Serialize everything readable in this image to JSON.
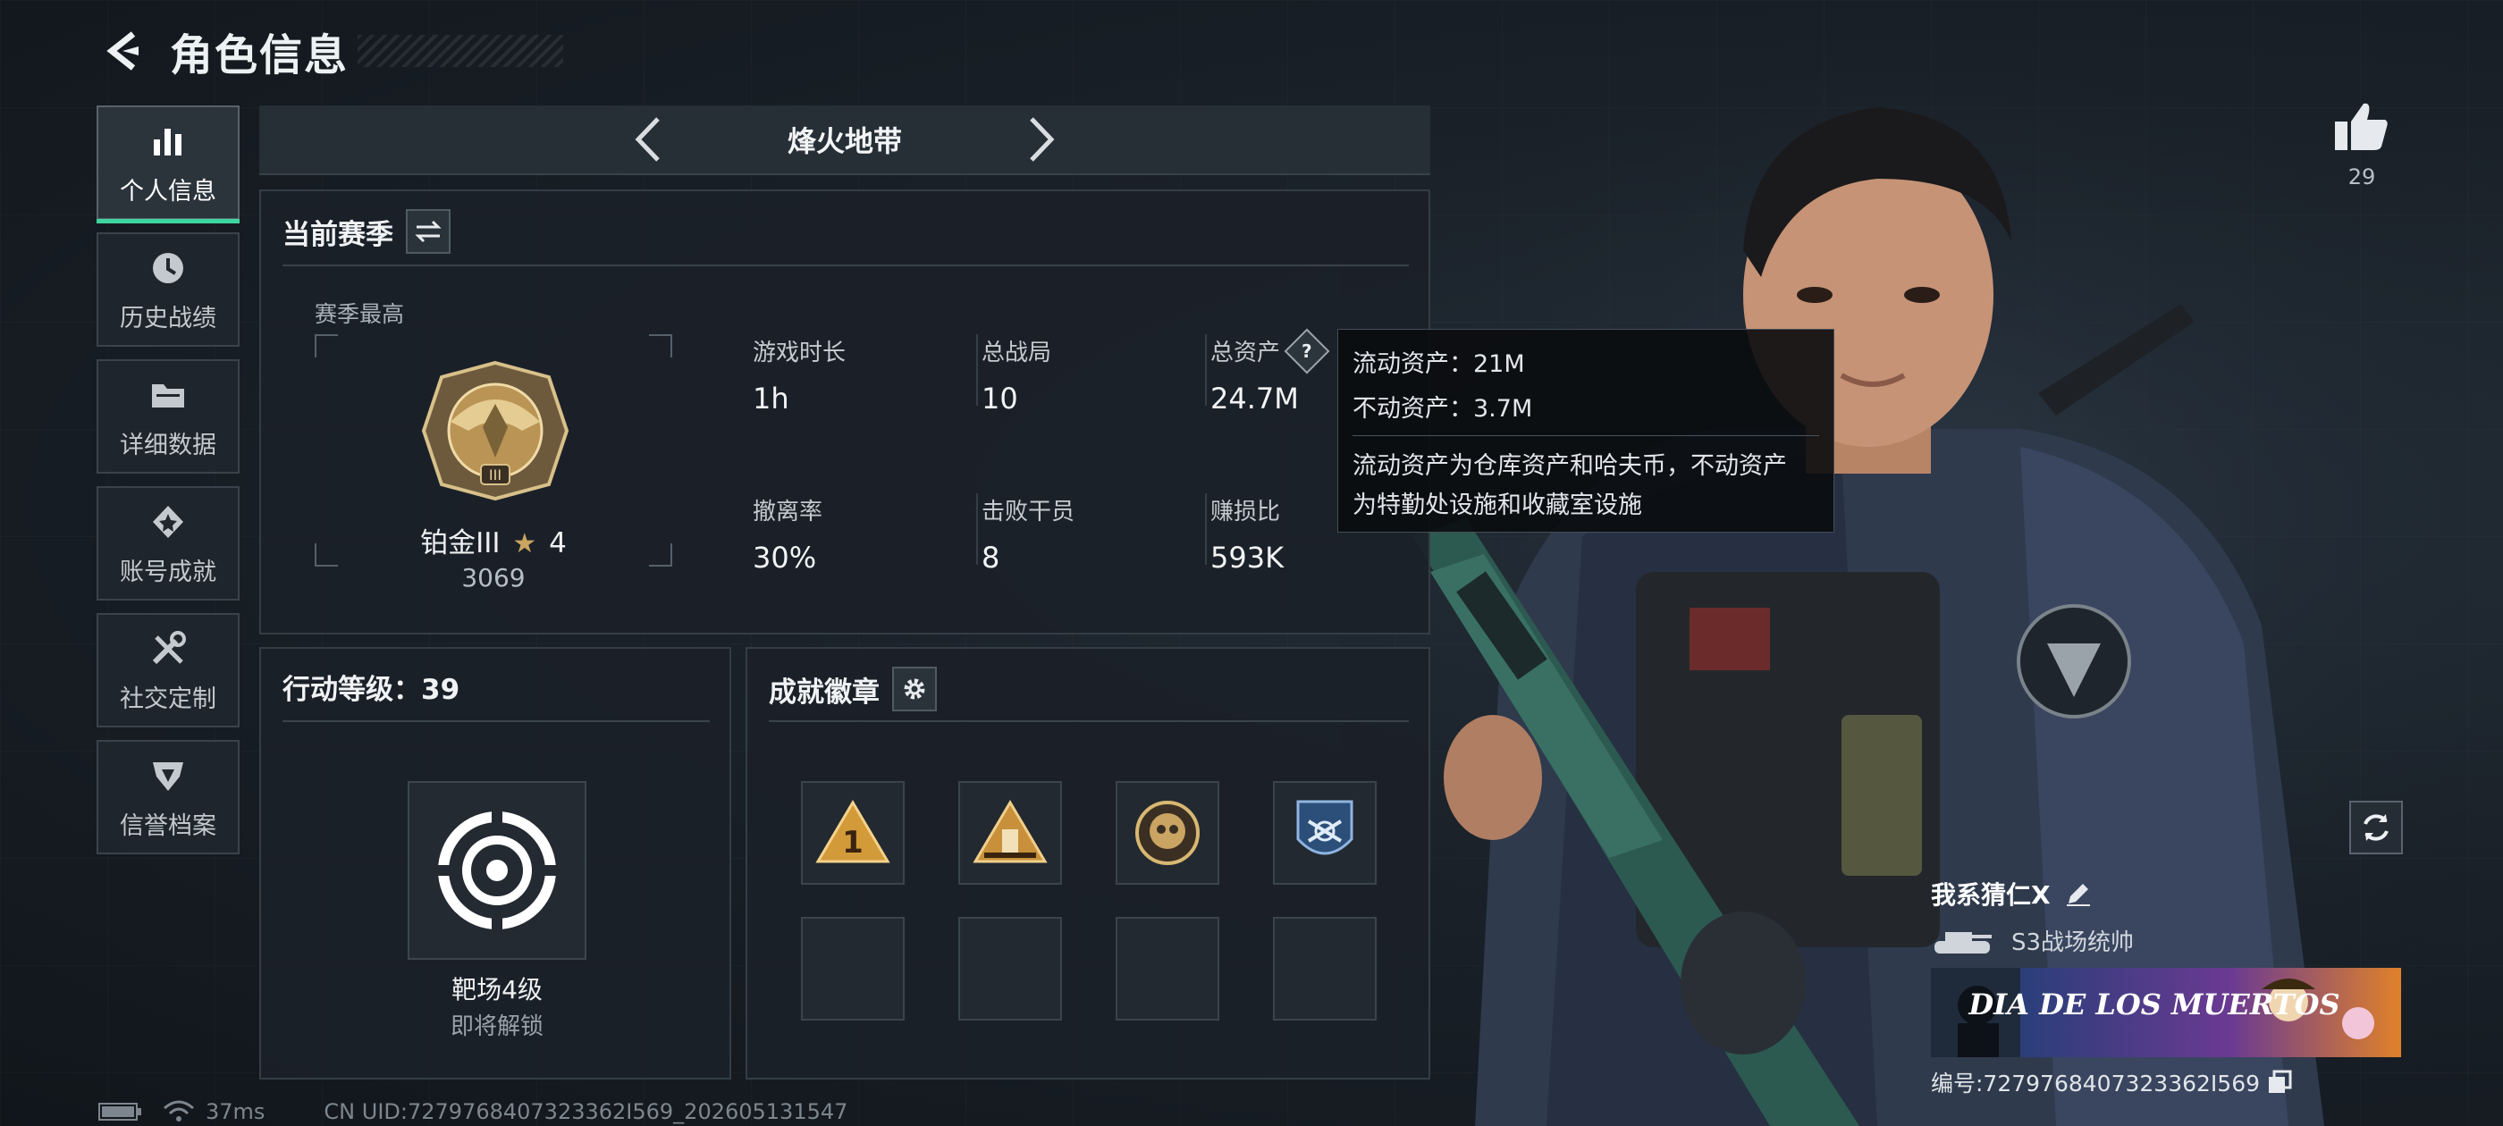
{
  "header": {
    "title": "角色信息"
  },
  "sidebar": {
    "items": [
      {
        "label": "个人信息",
        "icon": "bar-chart-icon",
        "active": true
      },
      {
        "label": "历史战绩",
        "icon": "clock-icon",
        "active": false
      },
      {
        "label": "详细数据",
        "icon": "folder-icon",
        "active": false
      },
      {
        "label": "账号成就",
        "icon": "achievement-icon",
        "active": false
      },
      {
        "label": "社交定制",
        "icon": "tools-icon",
        "active": false
      },
      {
        "label": "信誉档案",
        "icon": "shield-icon",
        "active": false
      }
    ]
  },
  "mode": {
    "title": "烽火地带"
  },
  "season": {
    "title": "当前赛季",
    "best_label": "赛季最高",
    "rank_name": "铂金III",
    "rank_stars": "4",
    "rank_score": "3069",
    "stats": [
      {
        "label": "游戏时长",
        "value": "1h"
      },
      {
        "label": "总战局",
        "value": "10"
      },
      {
        "label": "总资产",
        "value": "24.7M"
      },
      {
        "label": "撤离率",
        "value": "30%"
      },
      {
        "label": "击败干员",
        "value": "8"
      },
      {
        "label": "赚损比",
        "value": "593K"
      }
    ],
    "help_symbol": "?"
  },
  "tooltip": {
    "liquid": "流动资产：21M",
    "fixed": "不动资产：3.7M",
    "desc_line1": "流动资产为仓库资产和哈夫币，不动资产",
    "desc_line2": "为特勤处设施和收藏室设施"
  },
  "level": {
    "title": "行动等级：39",
    "name": "靶场4级",
    "status": "即将解锁"
  },
  "badges": {
    "title": "成就徽章"
  },
  "like": {
    "count": "29"
  },
  "profile": {
    "name": "我系猜仁X",
    "title": "S3战场统帅",
    "banner_text": "DIA DE LOS MUERTOS",
    "id": "编号:7279768407323362I569"
  },
  "footer": {
    "ping": "37ms",
    "uid": "CN UID:7279768407323362I569_202605131547"
  },
  "colors": {
    "accent": "#3ed6a0",
    "gold": "#c9a560"
  }
}
